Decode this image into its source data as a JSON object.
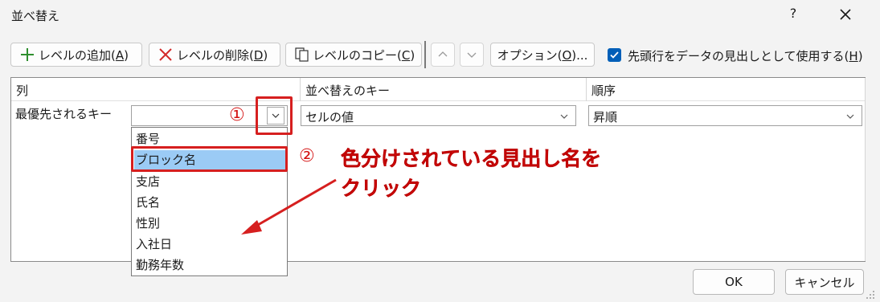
{
  "window": {
    "title": "並べ替え",
    "help": "?"
  },
  "toolbar": {
    "add_level": {
      "text": "レベルの追加(",
      "key": "A",
      "end": ")"
    },
    "delete_level": {
      "text": "レベルの削除(",
      "key": "D",
      "end": ")"
    },
    "copy_level": {
      "text": "レベルのコピー(",
      "key": "C",
      "end": ")"
    },
    "options": {
      "text": "オプション(",
      "key": "O",
      "end": ")..."
    },
    "header_checkbox": {
      "checked": true,
      "text": "先頭行をデータの見出しとして使用する(",
      "key": "H",
      "end": ")"
    }
  },
  "grid": {
    "headers": {
      "column": "列",
      "sort_on": "並べ替えのキー",
      "order": "順序"
    },
    "row": {
      "label": "最優先されるキー",
      "column_value": "",
      "sort_on_value": "セルの値",
      "order_value": "昇順"
    }
  },
  "dropdown": {
    "items": [
      "番号",
      "ブロック名",
      "支店",
      "氏名",
      "性別",
      "入社日",
      "勤務年数"
    ],
    "selected_index": 1
  },
  "annotations": {
    "step1": "①",
    "step2_marker": "②",
    "step2_line1": "色分けされている見出し名を",
    "step2_line2": "クリック"
  },
  "footer": {
    "ok": "OK",
    "cancel": "キャンセル"
  },
  "colors": {
    "accent": "#005fb8",
    "annotation_red": "#d61f1f",
    "selection": "#9bcbf5"
  }
}
